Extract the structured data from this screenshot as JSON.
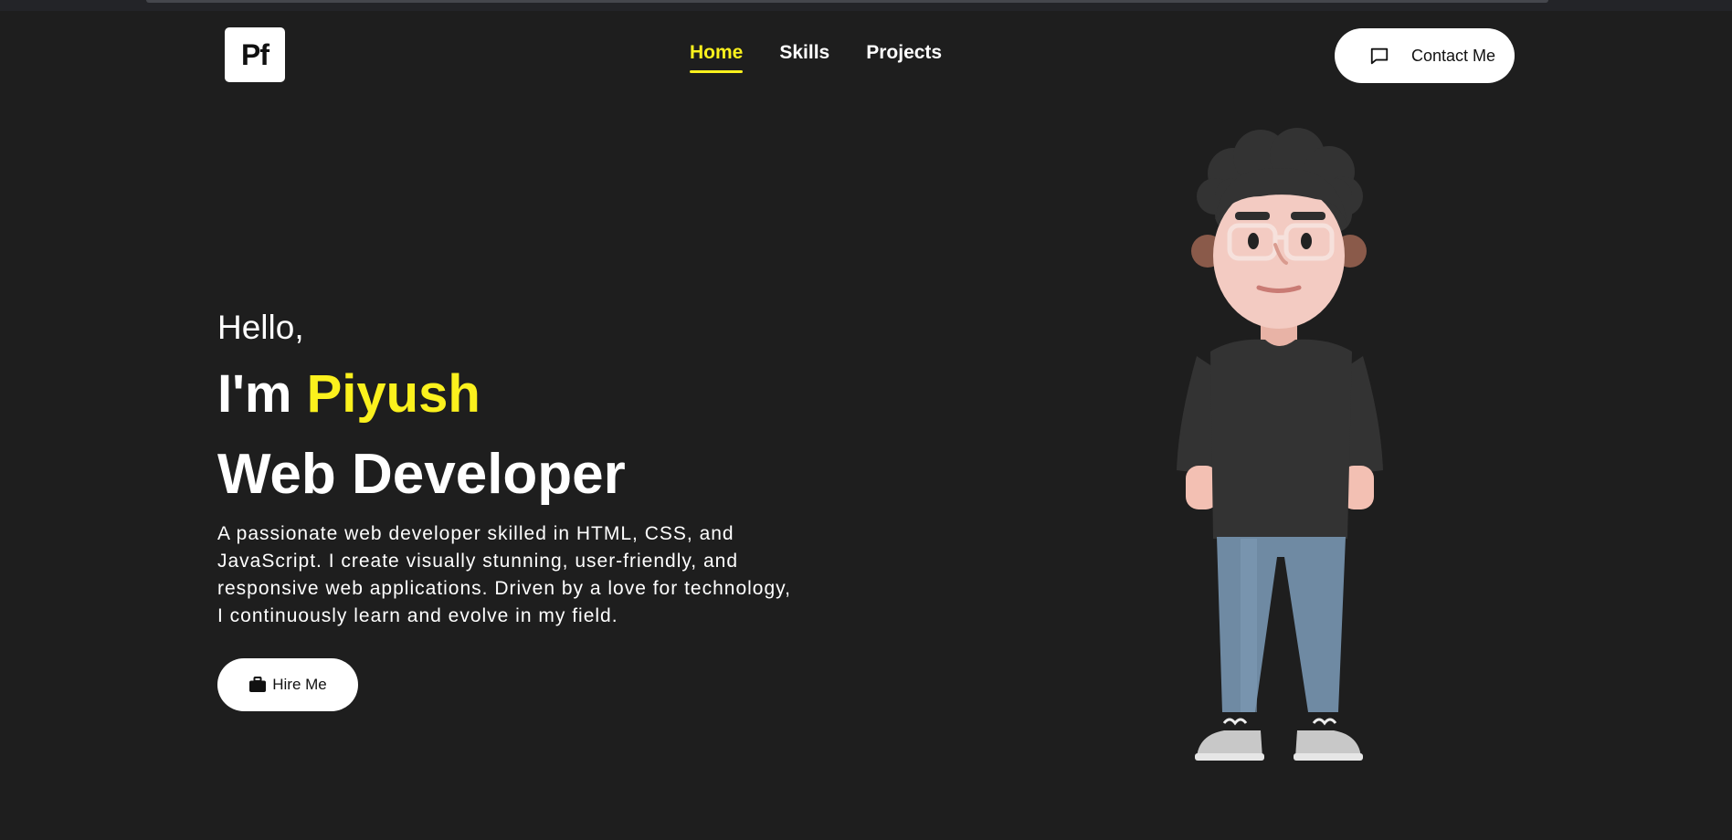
{
  "header": {
    "logo_text": "Pf",
    "nav": [
      {
        "label": "Home",
        "active": true
      },
      {
        "label": "Skills",
        "active": false
      },
      {
        "label": "Projects",
        "active": false
      }
    ],
    "contact_label": "Contact Me",
    "contact_icon": "message-square-icon"
  },
  "hero": {
    "greeting": "Hello,",
    "intro_prefix": "I'm ",
    "name": "Piyush",
    "role": "Web Developer",
    "description": "A passionate web developer skilled in HTML, CSS, and JavaScript. I create visually stunning, user-friendly, and responsive web applications. Driven by a love for technology, I continuously learn and evolve in my field.",
    "hire_label": "Hire Me",
    "hire_icon": "briefcase-icon"
  },
  "colors": {
    "background": "#1e1e1e",
    "accent": "#fbf11d",
    "button_bg": "#ffffff"
  }
}
